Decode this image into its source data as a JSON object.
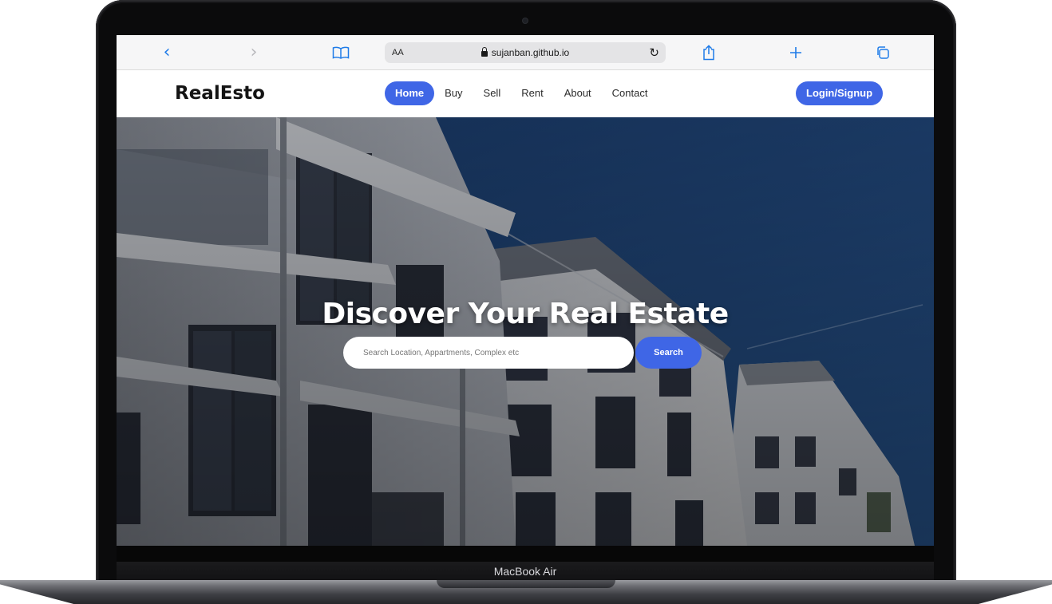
{
  "device": {
    "model_label": "MacBook Air"
  },
  "browser": {
    "text_size_label": "AA",
    "url": "sujanban.github.io",
    "icons": {
      "back": "chevron-left-icon",
      "forward": "chevron-right-icon",
      "bookmarks": "book-icon",
      "reload": "reload-icon",
      "share": "share-icon",
      "new_tab": "plus-icon",
      "tabs": "tabs-icon"
    }
  },
  "site": {
    "logo": "RealEsto",
    "nav": [
      {
        "label": "Home",
        "active": true
      },
      {
        "label": "Buy",
        "active": false
      },
      {
        "label": "Sell",
        "active": false
      },
      {
        "label": "Rent",
        "active": false
      },
      {
        "label": "About",
        "active": false
      },
      {
        "label": "Contact",
        "active": false
      }
    ],
    "login_label": "Login/Signup",
    "accent_color": "#3f66e6"
  },
  "hero": {
    "title": "Discover Your Real Estate",
    "search_placeholder": "Search Location, Appartments, Complex etc",
    "search_value": "",
    "search_button": "Search",
    "background": "apartment-buildings-photo"
  }
}
